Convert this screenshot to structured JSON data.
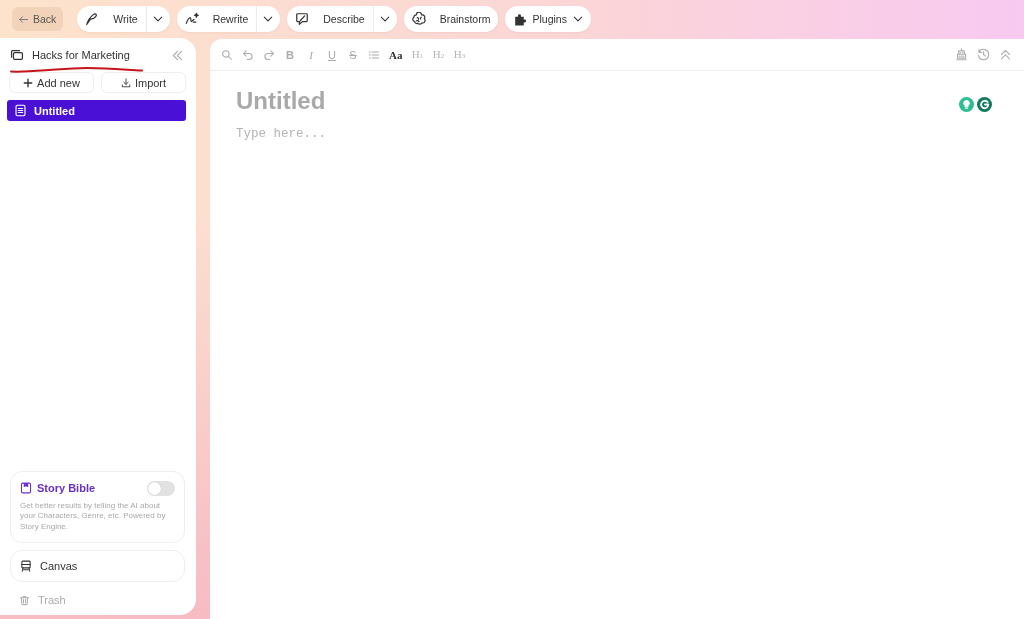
{
  "toolbar": {
    "back": {
      "label": "Back"
    },
    "tools": [
      {
        "label": "Write",
        "kind": "split"
      },
      {
        "label": "Rewrite",
        "kind": "split"
      },
      {
        "label": "Describe",
        "kind": "split"
      },
      {
        "label": "Brainstorm",
        "kind": "plain"
      },
      {
        "label": "Plugins",
        "kind": "menu"
      }
    ]
  },
  "sidebar": {
    "project": {
      "title": "Hacks for Marketing",
      "underlined": true
    },
    "actions": [
      {
        "label": "Add new"
      },
      {
        "label": "Import"
      }
    ],
    "documents": [
      {
        "title": "Untitled",
        "selected": true
      }
    ],
    "story_bible": {
      "title": "Story Bible",
      "on": false,
      "description": "Get better results by telling the AI about your Characters, Genre, etc. Powered by Story Engine."
    },
    "canvas": {
      "label": "Canvas"
    },
    "trash": {
      "label": "Trash"
    }
  },
  "editor": {
    "format_tools": [
      {
        "kind": "search"
      },
      {
        "kind": "undo"
      },
      {
        "kind": "redo"
      },
      {
        "kind": "bold",
        "label": "B"
      },
      {
        "kind": "italic",
        "label": "I"
      },
      {
        "kind": "underline",
        "label": "U"
      },
      {
        "kind": "strike",
        "label": "S"
      },
      {
        "kind": "list"
      },
      {
        "kind": "font",
        "label": "Aa"
      },
      {
        "kind": "heading",
        "label": "H$_{1}$"
      },
      {
        "kind": "heading",
        "label": "H$_{2}$"
      },
      {
        "kind": "heading",
        "label": "H$_{3}$"
      }
    ],
    "title": {
      "placeholder": "Untitled"
    },
    "body": {
      "placeholder": "Type here..."
    }
  }
}
